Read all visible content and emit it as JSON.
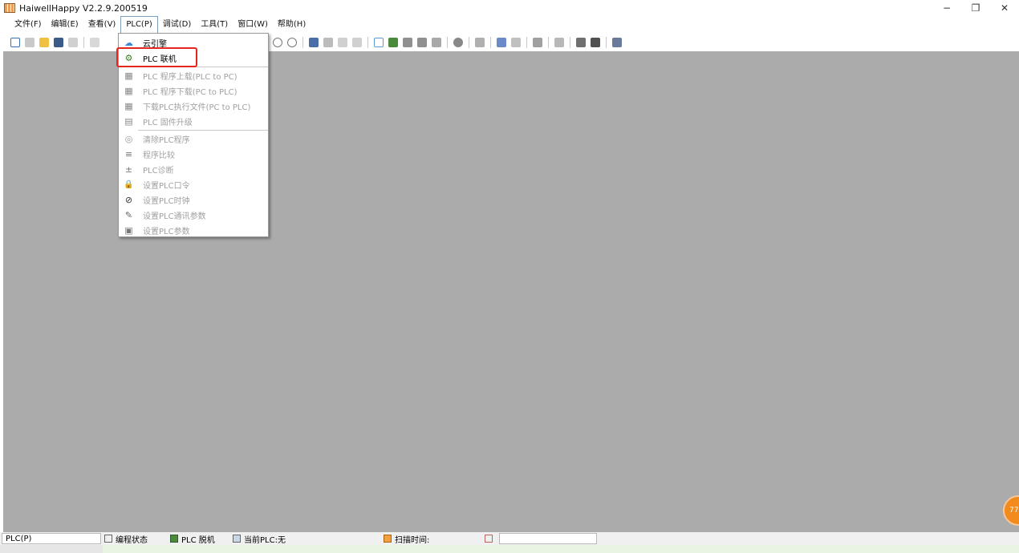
{
  "window": {
    "title": "HaiwellHappy V2.2.9.200519",
    "minimize": "−",
    "maximize": "❐",
    "close": "✕"
  },
  "menubar": {
    "items": [
      {
        "label": "文件(F)"
      },
      {
        "label": "编辑(E)"
      },
      {
        "label": "查看(V)"
      },
      {
        "label": "PLC(P)"
      },
      {
        "label": "调试(D)"
      },
      {
        "label": "工具(T)"
      },
      {
        "label": "窗口(W)"
      },
      {
        "label": "帮助(H)"
      }
    ]
  },
  "dropdown": {
    "items": [
      {
        "label": "云引擎",
        "icon": "cloud-icon",
        "glyph": "☁"
      },
      {
        "label": "PLC 联机",
        "icon": "plc-online-icon",
        "glyph": "⚙"
      },
      {
        "label": "PLC 程序上载(PLC to PC)",
        "icon": "upload-icon",
        "glyph": "▦"
      },
      {
        "label": "PLC 程序下载(PC to PLC)",
        "icon": "download-icon",
        "glyph": "▦"
      },
      {
        "label": "下载PLC执行文件(PC to PLC)",
        "icon": "download-exec-icon",
        "glyph": "▦"
      },
      {
        "label": "PLC 固件升级",
        "icon": "firmware-icon",
        "glyph": "▤"
      },
      {
        "label": "清除PLC程序",
        "icon": "clear-icon",
        "glyph": "◎"
      },
      {
        "label": "程序比较",
        "icon": "compare-icon",
        "glyph": "≡"
      },
      {
        "label": "PLC诊断",
        "icon": "diagnose-icon",
        "glyph": "±"
      },
      {
        "label": "设置PLC口令",
        "icon": "lock-icon",
        "glyph": "🔒"
      },
      {
        "label": "设置PLC时钟",
        "icon": "clock-icon",
        "glyph": "⊘"
      },
      {
        "label": "设置PLC通讯参数",
        "icon": "comm-icon",
        "glyph": "✎"
      },
      {
        "label": "设置PLC参数",
        "icon": "params-icon",
        "glyph": "▣"
      }
    ]
  },
  "statusbar": {
    "plc_menu": "PLC(P)",
    "mode": "编程状态",
    "connection": "PLC 脱机",
    "current_plc": "当前PLC:无",
    "scan_time": "扫描时间:"
  },
  "badge": {
    "text": "77"
  }
}
